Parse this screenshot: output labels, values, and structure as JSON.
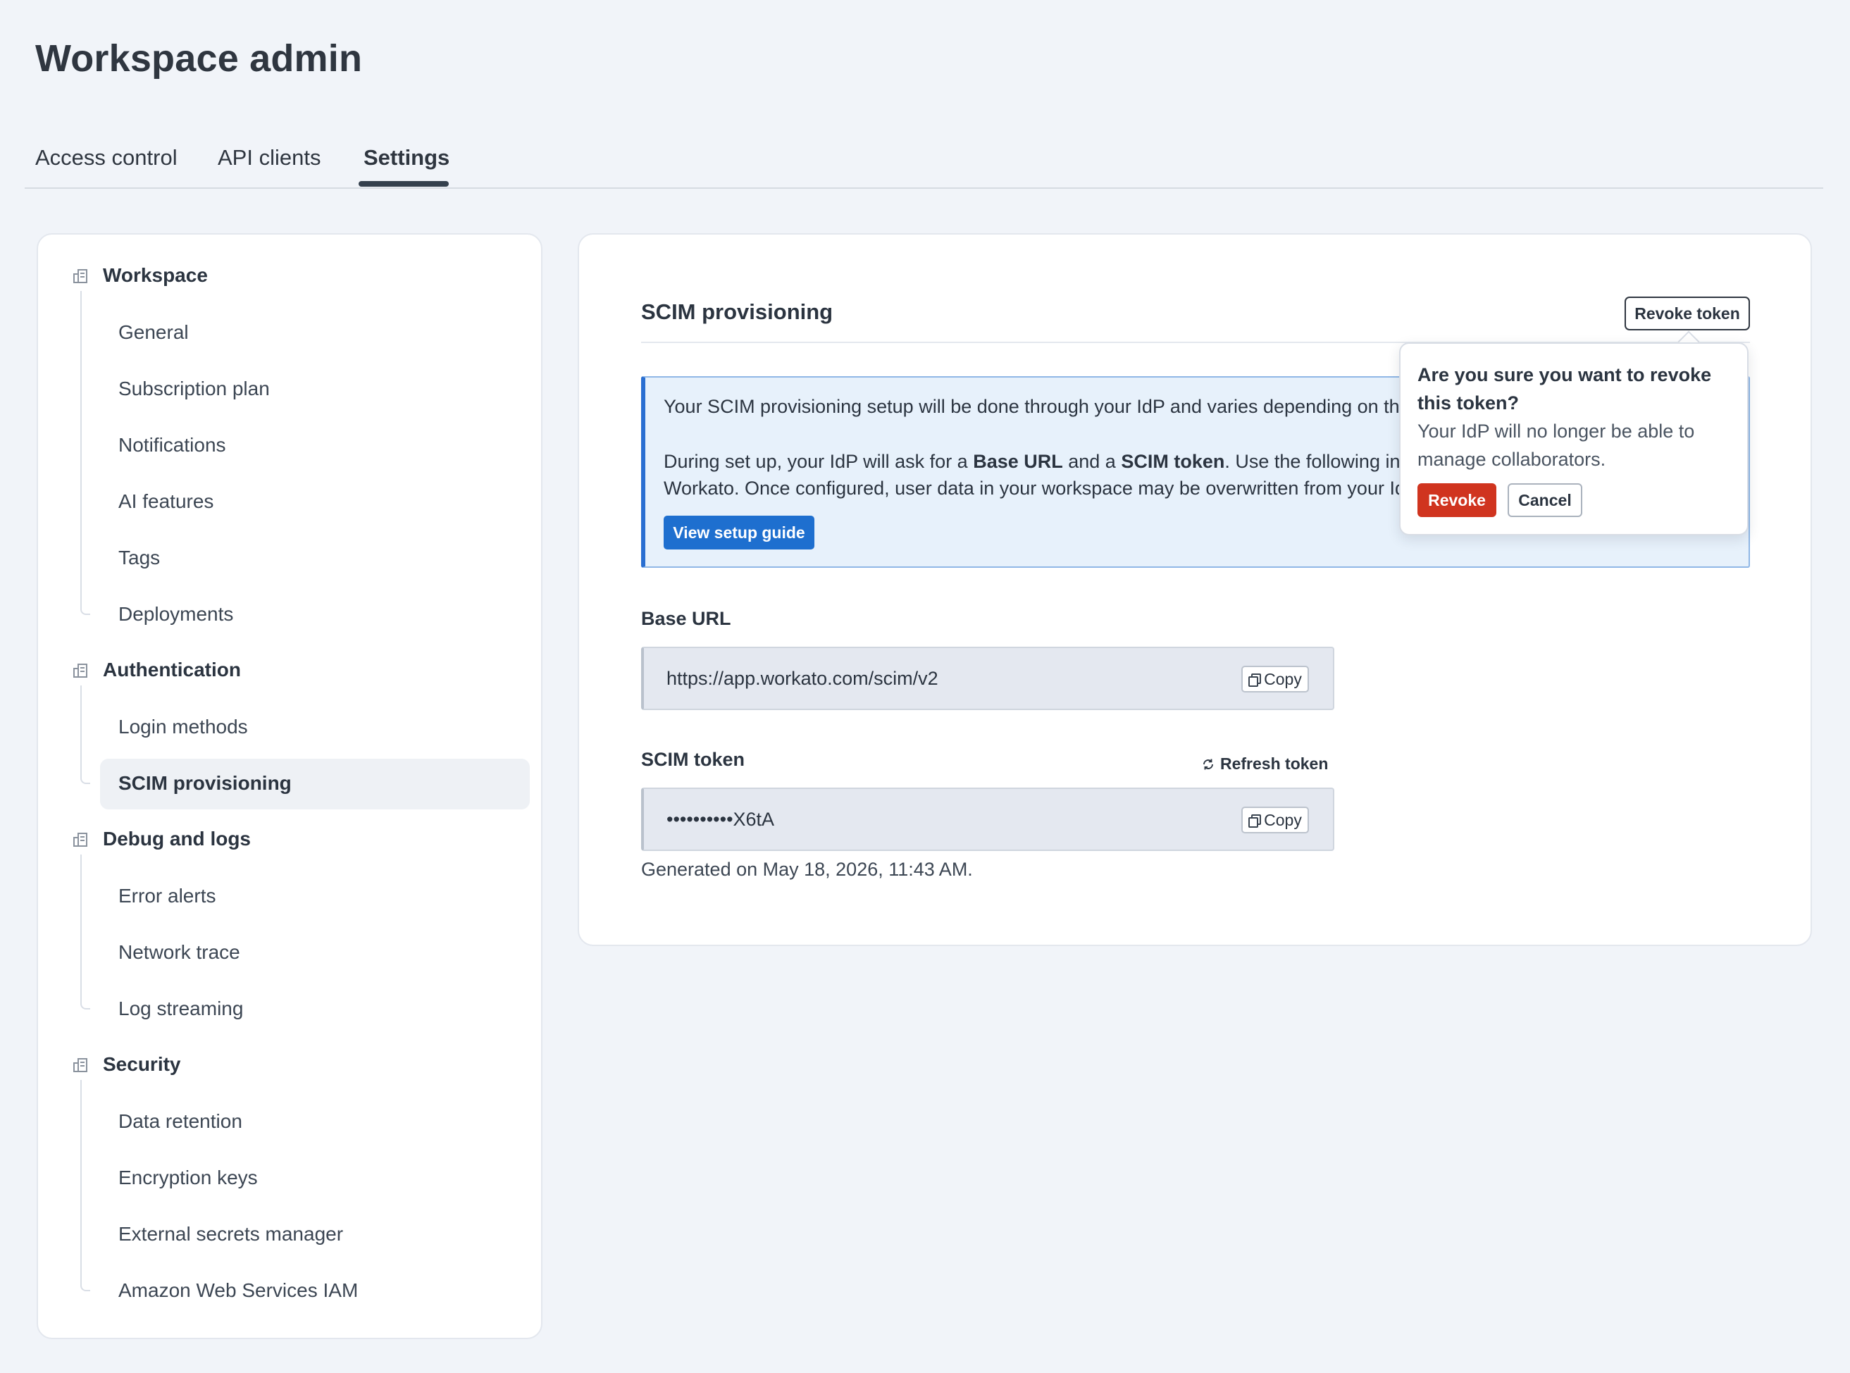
{
  "page": {
    "title": "Workspace admin"
  },
  "tabs": [
    {
      "label": "Access control",
      "active": false
    },
    {
      "label": "API clients",
      "active": false
    },
    {
      "label": "Settings",
      "active": true
    }
  ],
  "sidebar": {
    "groups": [
      {
        "title": "Workspace",
        "icon": "building-icon",
        "items": [
          "General",
          "Subscription plan",
          "Notifications",
          "AI features",
          "Tags",
          "Deployments"
        ]
      },
      {
        "title": "Authentication",
        "icon": "building-icon",
        "items": [
          "Login methods",
          "SCIM provisioning"
        ]
      },
      {
        "title": "Debug and logs",
        "icon": "building-icon",
        "items": [
          "Error alerts",
          "Network trace",
          "Log streaming"
        ]
      },
      {
        "title": "Security",
        "icon": "building-icon",
        "items": [
          "Data retention",
          "Encryption keys",
          "External secrets manager",
          "Amazon Web Services IAM"
        ]
      }
    ],
    "active_item": "SCIM provisioning"
  },
  "main": {
    "section_title": "SCIM provisioning",
    "revoke_token_label": "Revoke token",
    "info": {
      "line1": "Your SCIM provisioning setup will be done through your IdP and varies depending on the Id",
      "line2_pre": "During set up, your IdP will ask for a ",
      "line2_b1": "Base URL",
      "line2_mid": " and a ",
      "line2_b2": "SCIM token",
      "line2_post": ". Use the following inputs",
      "line3": "Workato. Once configured, user data in your workspace may be overwritten from your IdP.",
      "button": "View setup guide"
    },
    "base_url": {
      "label": "Base URL",
      "value": "https://app.workato.com/scim/v2",
      "copy_label": "Copy"
    },
    "scim_token": {
      "label": "SCIM token",
      "refresh_label": "Refresh token",
      "value": "••••••••••X6tA",
      "copy_label": "Copy",
      "generated": "Generated on May 18, 2026, 11:43 AM."
    }
  },
  "popover": {
    "title": "Are you sure you want to revoke this token?",
    "body": "Your IdP will no longer be able to manage collaborators.",
    "confirm_label": "Revoke",
    "cancel_label": "Cancel"
  },
  "colors": {
    "primary": "#1e6fcf",
    "danger": "#d0341f",
    "info_bg": "#e7f1fb",
    "page_bg": "#f1f4f9"
  }
}
